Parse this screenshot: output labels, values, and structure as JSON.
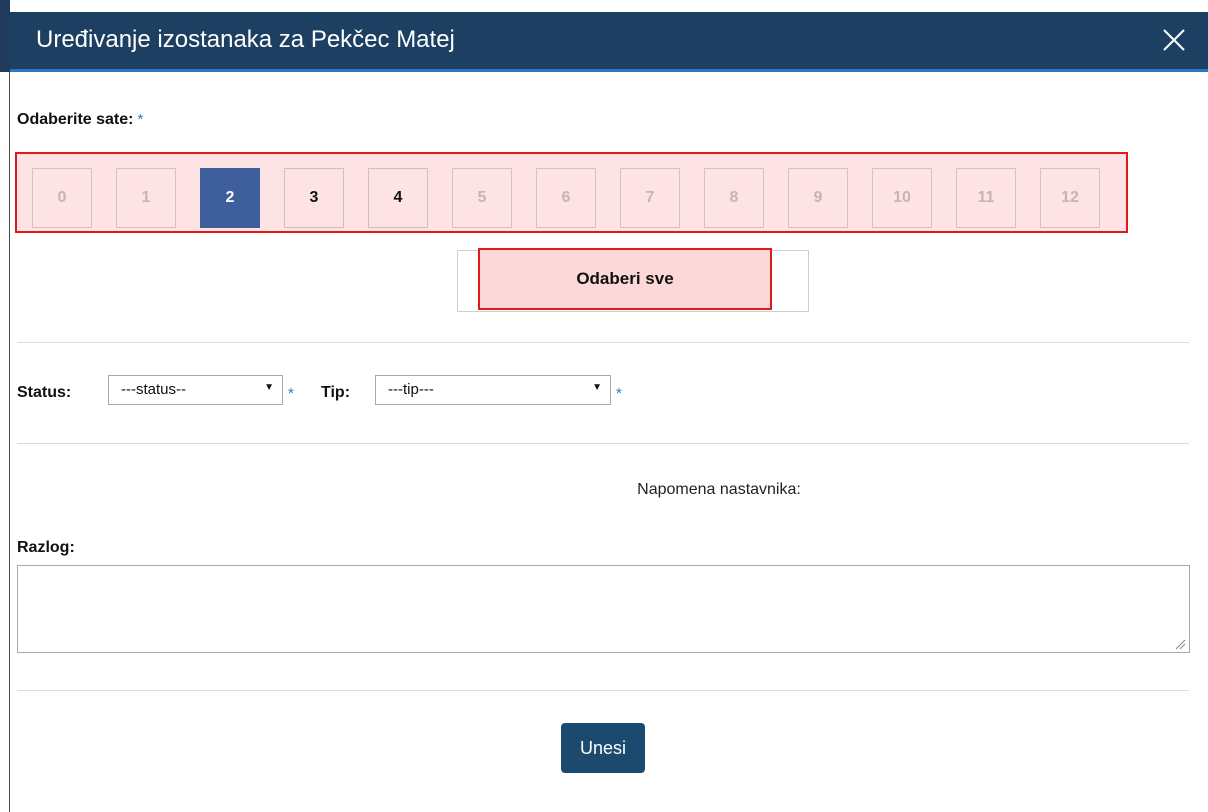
{
  "modal": {
    "title": "Uređivanje izostanaka za Pekčec Matej"
  },
  "hours": {
    "label": "Odaberite sate:",
    "required_mark": "*",
    "items": [
      {
        "label": "0",
        "state": "disabled"
      },
      {
        "label": "1",
        "state": "disabled"
      },
      {
        "label": "2",
        "state": "selected"
      },
      {
        "label": "3",
        "state": "available"
      },
      {
        "label": "4",
        "state": "available"
      },
      {
        "label": "5",
        "state": "disabled"
      },
      {
        "label": "6",
        "state": "disabled"
      },
      {
        "label": "7",
        "state": "disabled"
      },
      {
        "label": "8",
        "state": "disabled"
      },
      {
        "label": "9",
        "state": "disabled"
      },
      {
        "label": "10",
        "state": "disabled"
      },
      {
        "label": "11",
        "state": "disabled"
      },
      {
        "label": "12",
        "state": "disabled"
      }
    ],
    "select_all_label": "Odaberi sve"
  },
  "filters": {
    "status_label": "Status:",
    "status_value": "---status--",
    "tip_label": "Tip:",
    "tip_value": "---tip---",
    "required_mark": "*"
  },
  "note": {
    "label": "Napomena nastavnika:"
  },
  "reason": {
    "label": "Razlog:",
    "value": ""
  },
  "actions": {
    "submit_label": "Unesi"
  },
  "colors": {
    "header_bg": "#1c3f62",
    "selected_hour": "#3e5f9c",
    "highlight_border": "#e01919",
    "highlight_fill": "#fde3e3",
    "submit_bg": "#1c4a6e",
    "required_star": "#2a7abf"
  }
}
